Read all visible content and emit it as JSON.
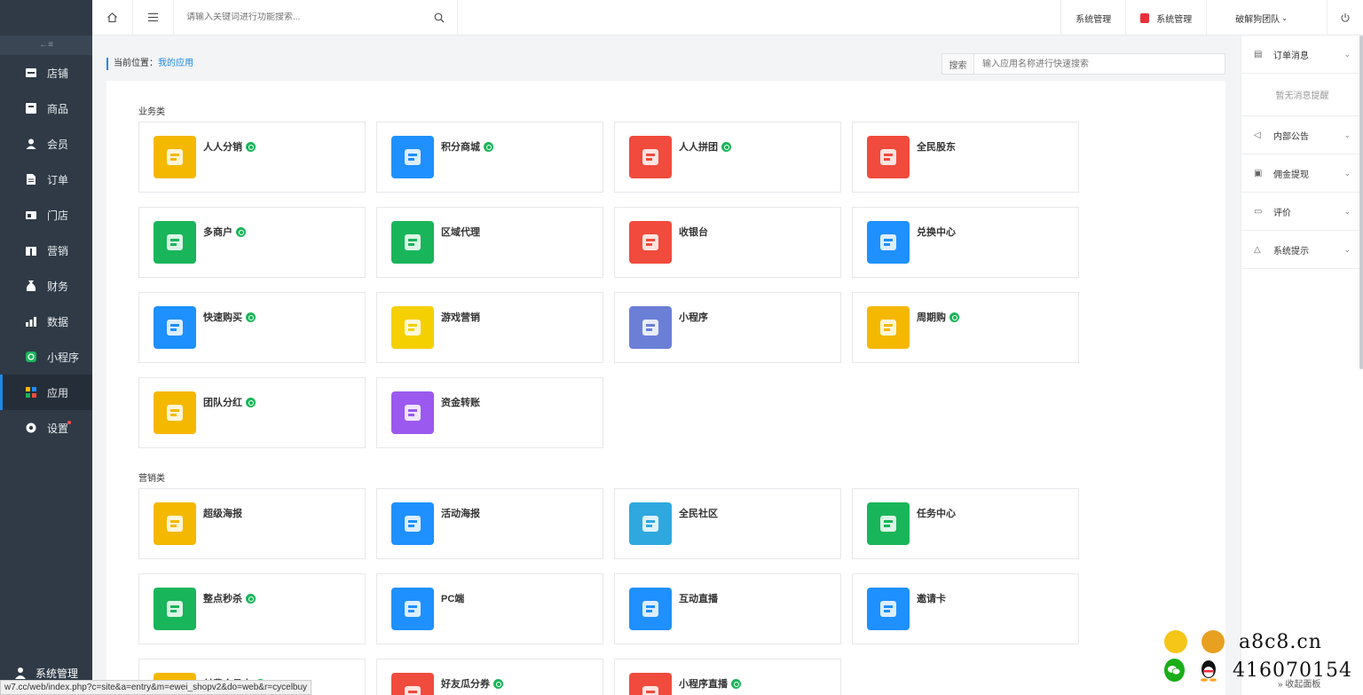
{
  "sidebar": {
    "collapse_glyph": "←≡",
    "items": [
      {
        "label": "店铺",
        "icon": "store-icon"
      },
      {
        "label": "商品",
        "icon": "goods-icon"
      },
      {
        "label": "会员",
        "icon": "member-icon"
      },
      {
        "label": "订单",
        "icon": "order-icon"
      },
      {
        "label": "门店",
        "icon": "shop-icon"
      },
      {
        "label": "营销",
        "icon": "gift-icon"
      },
      {
        "label": "财务",
        "icon": "money-bag-icon"
      },
      {
        "label": "数据",
        "icon": "chart-icon"
      },
      {
        "label": "小程序",
        "icon": "miniapp-icon"
      },
      {
        "label": "应用",
        "icon": "apps-icon"
      },
      {
        "label": "设置",
        "icon": "settings-icon"
      }
    ],
    "bottom_label": "系统管理"
  },
  "topbar": {
    "search_placeholder": "请输入关键词进行功能搜索...",
    "links": [
      "系统管理",
      "系统管理",
      "破解狗团队"
    ]
  },
  "breadcrumb": {
    "prefix": "当前位置：",
    "current": "我的应用"
  },
  "app_search": {
    "label": "搜索",
    "placeholder": "输入应用名称进行快速搜索"
  },
  "sections": [
    {
      "title": "业务类",
      "cards": [
        {
          "name": "人人分销",
          "badge": true,
          "color": "#f5b800"
        },
        {
          "name": "积分商城",
          "badge": true,
          "color": "#1e90ff"
        },
        {
          "name": "人人拼团",
          "badge": true,
          "color": "#f04b3c"
        },
        {
          "name": "全民股东",
          "badge": false,
          "color": "#f04b3c"
        },
        {
          "name": "多商户",
          "badge": true,
          "color": "#19b55a"
        },
        {
          "name": "区域代理",
          "badge": false,
          "color": "#19b55a"
        },
        {
          "name": "收银台",
          "badge": false,
          "color": "#f04b3c"
        },
        {
          "name": "兑换中心",
          "badge": false,
          "color": "#1e90ff"
        },
        {
          "name": "快速购买",
          "badge": true,
          "color": "#1e90ff"
        },
        {
          "name": "游戏营销",
          "badge": false,
          "color": "#f5d000"
        },
        {
          "name": "小程序",
          "badge": false,
          "color": "#6b7fd7"
        },
        {
          "name": "周期购",
          "badge": true,
          "color": "#f5b800"
        },
        {
          "name": "团队分红",
          "badge": true,
          "color": "#f5b800"
        },
        {
          "name": "资金转账",
          "badge": false,
          "color": "#9b59f0"
        }
      ]
    },
    {
      "title": "营销类",
      "cards": [
        {
          "name": "超级海报",
          "badge": false,
          "color": "#f5b800"
        },
        {
          "name": "活动海报",
          "badge": false,
          "color": "#1e90ff"
        },
        {
          "name": "全民社区",
          "badge": false,
          "color": "#2fa8e0"
        },
        {
          "name": "任务中心",
          "badge": false,
          "color": "#19b55a"
        },
        {
          "name": "整点秒杀",
          "badge": true,
          "color": "#19b55a"
        },
        {
          "name": "PC端",
          "badge": false,
          "color": "#1e90ff"
        },
        {
          "name": "互动直播",
          "badge": false,
          "color": "#1e90ff"
        },
        {
          "name": "邀请卡",
          "badge": false,
          "color": "#1e90ff"
        },
        {
          "name": "付费会员卡",
          "badge": true,
          "color": "#f5b800"
        },
        {
          "name": "好友瓜分券",
          "badge": true,
          "color": "#f04b3c"
        },
        {
          "name": "小程序直播",
          "badge": true,
          "color": "#f04b3c"
        }
      ]
    }
  ],
  "right_panel": {
    "items": [
      {
        "label": "订单消息",
        "icon": "document-icon"
      },
      {
        "label": "内部公告",
        "icon": "speaker-icon"
      },
      {
        "label": "佣金提现",
        "icon": "wallet-icon"
      },
      {
        "label": "评价",
        "icon": "comment-icon"
      },
      {
        "label": "系统提示",
        "icon": "bell-icon"
      }
    ],
    "empty_text": "暂无消息提醒",
    "collapse_label": "» 收起面板"
  },
  "status_url": "w7.cc/web/index.php?c=site&a=entry&m=ewei_shopv2&do=web&r=cycelbuy",
  "watermark": {
    "line1": "a8c8.cn",
    "line2": "416070154"
  }
}
